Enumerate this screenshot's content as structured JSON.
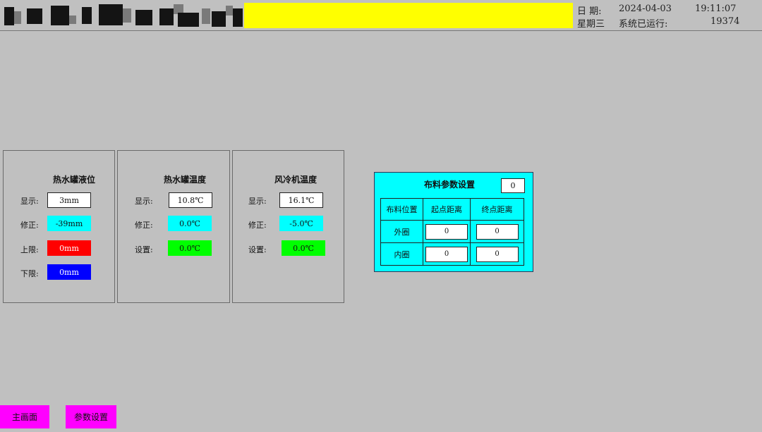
{
  "header": {
    "date_label": "日 期:",
    "date_value": "2024-04-03",
    "time_value": "19:11:07",
    "weekday": "星期三",
    "runtime_label": "系统已运行:",
    "runtime_value": "19374",
    "banner_color": "#ffff00"
  },
  "panels": {
    "level": {
      "title": "热水罐液位",
      "display_label": "显示:",
      "display_value": "3mm",
      "correction_label": "修正:",
      "correction_value": "-39mm",
      "upper_label": "上限:",
      "upper_value": "0mm",
      "lower_label": "下限:",
      "lower_value": "0mm"
    },
    "tank_temp": {
      "title": "热水罐温度",
      "display_label": "显示:",
      "display_value": "10.8℃",
      "correction_label": "修正:",
      "correction_value": "0.0℃",
      "setting_label": "设置:",
      "setting_value": "0.0℃"
    },
    "fan_temp": {
      "title": "风冷机温度",
      "display_label": "显示:",
      "display_value": "16.1℃",
      "correction_label": "修正:",
      "correction_value": "-5.0℃",
      "setting_label": "设置:",
      "setting_value": "0.0℃"
    }
  },
  "distribution": {
    "title": "布料参数设置",
    "title_value": "0",
    "headers": [
      "布料位置",
      "起点距离",
      "终点距离"
    ],
    "rows": [
      {
        "label": "外圈",
        "start": "0",
        "end": "0"
      },
      {
        "label": "内圈",
        "start": "0",
        "end": "0"
      }
    ]
  },
  "nav": {
    "main_label": "主画面",
    "params_label": "参数设置"
  },
  "colors": {
    "background": "#c0c0c0",
    "accent_cyan": "#00ffff",
    "alarm_red": "#ff0000",
    "alarm_blue": "#0000ff",
    "ok_green": "#00ff00",
    "nav_magenta": "#ff00ff"
  }
}
